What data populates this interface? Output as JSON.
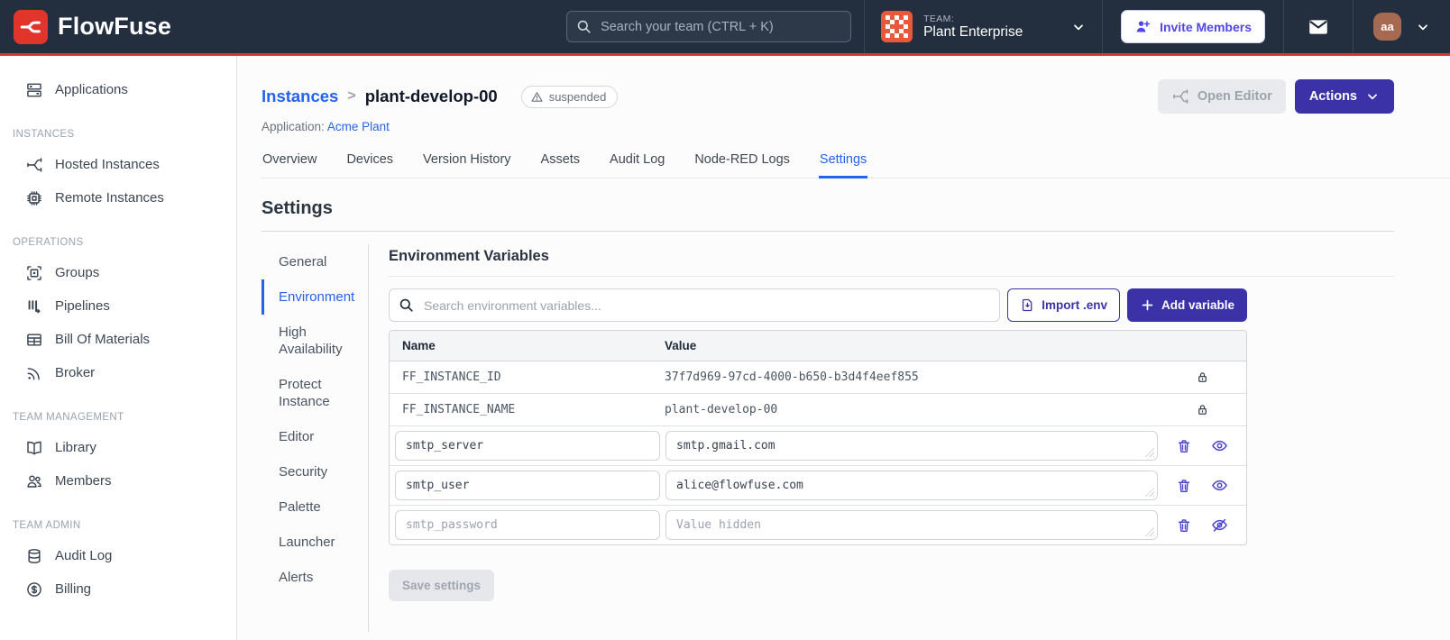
{
  "navbar": {
    "brand": "FlowFuse",
    "search_placeholder": "Search your team (CTRL + K)",
    "team_label": "TEAM:",
    "team_name": "Plant Enterprise",
    "invite_button": "Invite Members",
    "user_initials": "aa"
  },
  "sidebar": {
    "sections": [
      {
        "label": "",
        "items": [
          {
            "label": "Applications",
            "icon": "applications"
          }
        ]
      },
      {
        "label": "INSTANCES",
        "items": [
          {
            "label": "Hosted Instances",
            "icon": "fork"
          },
          {
            "label": "Remote Instances",
            "icon": "chip"
          }
        ]
      },
      {
        "label": "OPERATIONS",
        "items": [
          {
            "label": "Groups",
            "icon": "groups"
          },
          {
            "label": "Pipelines",
            "icon": "pipelines"
          },
          {
            "label": "Bill Of Materials",
            "icon": "table"
          },
          {
            "label": "Broker",
            "icon": "broker"
          }
        ]
      },
      {
        "label": "TEAM MANAGEMENT",
        "items": [
          {
            "label": "Library",
            "icon": "book"
          },
          {
            "label": "Members",
            "icon": "users"
          }
        ]
      },
      {
        "label": "TEAM ADMIN",
        "items": [
          {
            "label": "Audit Log",
            "icon": "database"
          },
          {
            "label": "Billing",
            "icon": "dollar"
          }
        ]
      }
    ]
  },
  "header": {
    "breadcrumb_parent": "Instances",
    "breadcrumb_separator": ">",
    "instance_name": "plant-develop-00",
    "status_badge": "suspended",
    "application_label": "Application:",
    "application_name": "Acme Plant",
    "open_editor_button": "Open Editor",
    "actions_button": "Actions"
  },
  "tabs": [
    {
      "label": "Overview",
      "active": false
    },
    {
      "label": "Devices",
      "active": false
    },
    {
      "label": "Version History",
      "active": false
    },
    {
      "label": "Assets",
      "active": false
    },
    {
      "label": "Audit Log",
      "active": false
    },
    {
      "label": "Node-RED Logs",
      "active": false
    },
    {
      "label": "Settings",
      "active": true
    }
  ],
  "settings": {
    "title": "Settings",
    "nav": [
      {
        "label": "General",
        "active": false
      },
      {
        "label": "Environment",
        "active": true
      },
      {
        "label": "High Availability",
        "active": false
      },
      {
        "label": "Protect Instance",
        "active": false
      },
      {
        "label": "Editor",
        "active": false
      },
      {
        "label": "Security",
        "active": false
      },
      {
        "label": "Palette",
        "active": false
      },
      {
        "label": "Launcher",
        "active": false
      },
      {
        "label": "Alerts",
        "active": false
      }
    ]
  },
  "env_panel": {
    "title": "Environment Variables",
    "search_placeholder": "Search environment variables...",
    "import_button": "Import .env",
    "add_button": "Add variable",
    "columns": [
      "Name",
      "Value"
    ],
    "locked_rows": [
      {
        "name": "FF_INSTANCE_ID",
        "value": "37f7d969-97cd-4000-b650-b3d4f4eef855",
        "lock_icon": "lock"
      },
      {
        "name": "FF_INSTANCE_NAME",
        "value": "plant-develop-00",
        "lock_icon": "lock"
      }
    ],
    "editable_rows": [
      {
        "name": "smtp_server",
        "name_muted": false,
        "value": "smtp.gmail.com",
        "value_placeholder": "",
        "visibility_icon": "eye",
        "delete_icon": "trash"
      },
      {
        "name": "smtp_user",
        "name_muted": false,
        "value": "alice@flowfuse.com",
        "value_placeholder": "",
        "visibility_icon": "eye",
        "delete_icon": "trash"
      },
      {
        "name": "smtp_password",
        "name_muted": true,
        "value": "",
        "value_placeholder": "Value hidden",
        "visibility_icon": "eye-off",
        "delete_icon": "trash"
      }
    ],
    "save_button": "Save settings"
  },
  "colors": {
    "navbar_bg": "#232e3e",
    "brand_red": "#e1342b",
    "accent_red": "#d6372f",
    "primary_indigo": "#3b32a8",
    "icon_indigo": "#4c44cf",
    "link_blue": "#2563eb"
  }
}
